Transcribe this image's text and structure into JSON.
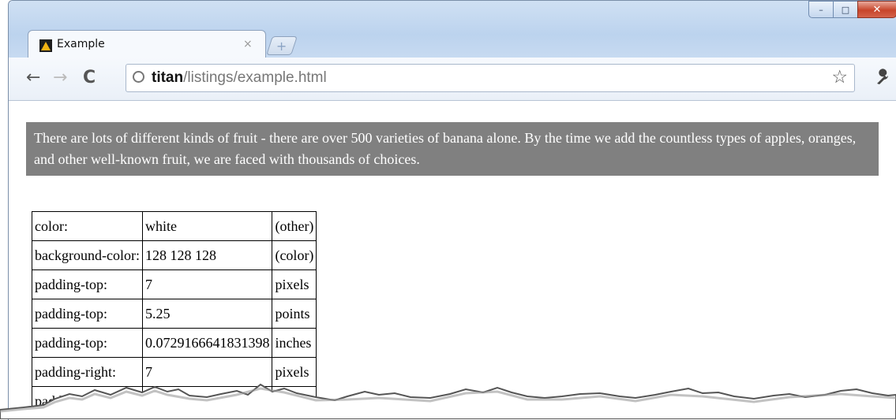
{
  "window": {
    "controls": {
      "minimize": "–",
      "maximize": "□",
      "close": "✕"
    }
  },
  "tab": {
    "title": "Example",
    "close": "×",
    "favicon": "warning-triangle-favicon",
    "newtab": "+"
  },
  "toolbar": {
    "back": "←",
    "forward": "→",
    "reload": "C",
    "url_host": "titan",
    "url_path": "/listings/example.html",
    "star": "☆",
    "wrench": "🔧"
  },
  "page": {
    "banner_text": "There are lots of different kinds of fruit - there are over 500 varieties of banana alone. By the time we add the countless types of apples, oranges, and other well-known fruit, we are faced with thousands of choices.",
    "table": {
      "rows": [
        [
          "color:",
          "white",
          "(other)"
        ],
        [
          "background-color:",
          "128 128 128",
          "(color)"
        ],
        [
          "padding-top:",
          "7",
          "pixels"
        ],
        [
          "padding-top:",
          "5.25",
          "points"
        ],
        [
          "padding-top:",
          "0.0729166641831398",
          "inches"
        ],
        [
          "padding-right:",
          "7",
          "pixels"
        ],
        [
          "padding-right:",
          "",
          ""
        ]
      ]
    }
  },
  "colors": {
    "banner_bg": "#808080",
    "banner_text": "#ffffff",
    "chrome_frame": "#bcd3ee",
    "close_button": "#c7452b"
  }
}
